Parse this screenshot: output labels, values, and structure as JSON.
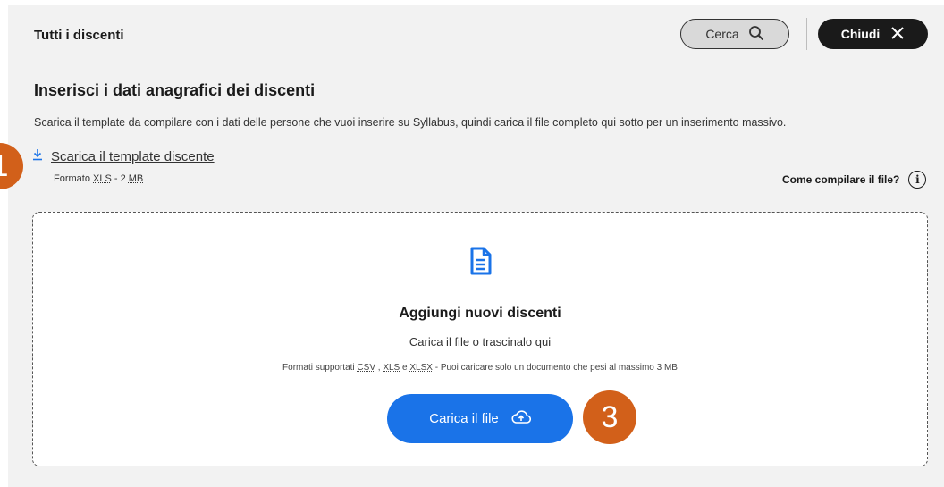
{
  "header": {
    "title": "Tutti i discenti",
    "search_label": "Cerca",
    "close_label": "Chiudi"
  },
  "section": {
    "heading": "Inserisci i dati anagrafici dei discenti",
    "description": "Scarica il template da compilare con i dati delle persone che vuoi inserire su Syllabus, quindi carica il file completo qui sotto per un inserimento massivo."
  },
  "download": {
    "label": "Scarica il template discente",
    "format_prefix": "Formato ",
    "format_abbr": "XLS",
    "format_sep": " - 2 ",
    "format_size_unit": "MB"
  },
  "help": {
    "label": "Come compilare il file?",
    "icon_glyph": "i"
  },
  "dropzone": {
    "title": "Aggiungi nuovi discenti",
    "subtitle": "Carica il file o trascinalo qui",
    "formats_prefix": "Formati supportati ",
    "formats_csv": "CSV",
    "formats_sep1": " , ",
    "formats_xls": "XLS",
    "formats_sep2": " e ",
    "formats_xlsx": "XLSX",
    "formats_suffix": " - Puoi caricare solo un documento che pesi al massimo 3 MB",
    "upload_label": "Carica il file"
  },
  "badges": {
    "first": "1",
    "third": "3"
  },
  "colors": {
    "panel_bg": "#f2f2f2",
    "accent": "#1a73e8",
    "badge": "#d2601a",
    "dark": "#1a1a1a"
  },
  "icons": [
    "search-icon",
    "close-icon",
    "download-icon",
    "info-icon",
    "document-icon",
    "cloud-upload-icon"
  ]
}
